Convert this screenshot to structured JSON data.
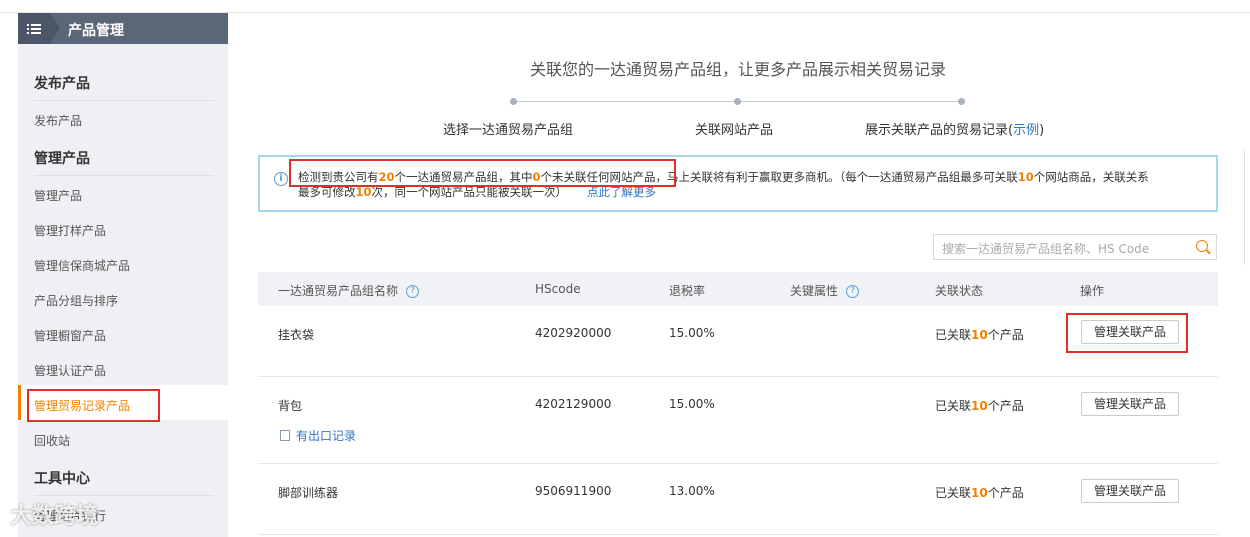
{
  "sidebar": {
    "header_title": "产品管理",
    "sections": [
      {
        "title": "发布产品",
        "items": [
          "发布产品"
        ]
      },
      {
        "title": "管理产品",
        "items": [
          "管理产品",
          "管理打样产品",
          "管理信保商城产品",
          "产品分组与排序",
          "管理橱窗产品",
          "管理认证产品",
          "管理贸易记录产品",
          "回收站"
        ]
      },
      {
        "title": "工具中心",
        "items": [
          "管理图片银行"
        ]
      }
    ],
    "active_item": "管理贸易记录产品"
  },
  "main": {
    "headline": "关联您的一达通贸易产品组，让更多产品展示相关贸易记录",
    "steps": [
      "选择一达通贸易产品组",
      "关联网站产品",
      "展示关联产品的贸易记录"
    ],
    "steps_example_prefix": "(",
    "steps_example_link": "示例",
    "steps_example_suffix": ")",
    "notice": {
      "p1": "检测到贵公司有",
      "n1": "20",
      "p2": "个一达通贸易产品组，其中",
      "n2": "0",
      "p3": "个未关联任何网站产品，马上关联将有利于赢取更多商机。（每个一达通贸易产品组最多可关联",
      "n3": "10",
      "p4": "个网站商品，关联关系",
      "p5": "最多可修改",
      "n4": "10",
      "p6": "次，同一个网站产品只能被关联一次）",
      "link": "点此了解更多"
    },
    "search_placeholder": "搜索一达通贸易产品组名称、HS Code",
    "table": {
      "headers": [
        "一达通贸易产品组名称",
        "HScode",
        "退税率",
        "关键属性",
        "关联状态",
        "操作"
      ],
      "rows": [
        {
          "name": "挂衣袋",
          "hscode": "4202920000",
          "rate": "15.00%",
          "status_prefix": "已关联",
          "status_count": "10",
          "status_suffix": "个产品",
          "action": "管理关联产品",
          "export": ""
        },
        {
          "name": "背包",
          "hscode": "4202129000",
          "rate": "15.00%",
          "status_prefix": "已关联",
          "status_count": "10",
          "status_suffix": "个产品",
          "action": "管理关联产品",
          "export": "有出口记录"
        },
        {
          "name": "脚部训练器",
          "hscode": "9506911900",
          "rate": "13.00%",
          "status_prefix": "已关联",
          "status_count": "10",
          "status_suffix": "个产品",
          "action": "管理关联产品",
          "export": ""
        }
      ]
    }
  },
  "watermark": "大数跨境",
  "colors": {
    "accent": "#f08200",
    "link": "#2a76c6",
    "highlight_box": "#e0302d",
    "sidebar_header": "#5a6778"
  }
}
